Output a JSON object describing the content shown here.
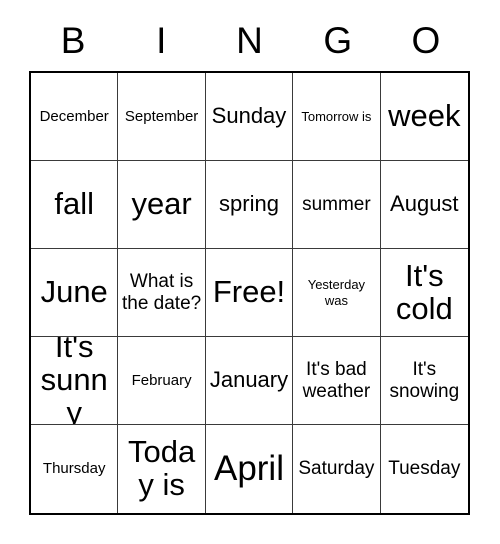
{
  "card": {
    "title": "BINGO",
    "header_letters": [
      "B",
      "I",
      "N",
      "G",
      "O"
    ],
    "grid_size": "5x5",
    "colors": {
      "background": "#ffffff",
      "text": "#000000",
      "outer_border": "#000000",
      "inner_gridline": "#3a3a3a"
    },
    "free_space": "Free!",
    "rows": [
      [
        {
          "text": "December",
          "size": "sm"
        },
        {
          "text": "September",
          "size": "sm"
        },
        {
          "text": "Sunday",
          "size": "lg"
        },
        {
          "text": "Tomorrow is",
          "size": "xs"
        },
        {
          "text": "week",
          "size": "xxl"
        }
      ],
      [
        {
          "text": "fall",
          "size": "xxl"
        },
        {
          "text": "year",
          "size": "xxl"
        },
        {
          "text": "spring",
          "size": "lg"
        },
        {
          "text": "summer",
          "size": "md"
        },
        {
          "text": "August",
          "size": "lg"
        }
      ],
      [
        {
          "text": "June",
          "size": "xxl"
        },
        {
          "text": "What is the date?",
          "size": "md"
        },
        {
          "text": "Free!",
          "size": "xxl"
        },
        {
          "text": "Yesterday was",
          "size": "xs"
        },
        {
          "text": "It's cold",
          "size": "xxl"
        }
      ],
      [
        {
          "text": "It's sunny",
          "size": "xxl"
        },
        {
          "text": "February",
          "size": "sm"
        },
        {
          "text": "January",
          "size": "lg"
        },
        {
          "text": "It's bad weather",
          "size": "md"
        },
        {
          "text": "It's snowing",
          "size": "md"
        }
      ],
      [
        {
          "text": "Thursday",
          "size": "sm"
        },
        {
          "text": "Today is",
          "size": "xxl"
        },
        {
          "text": "April",
          "size": "max"
        },
        {
          "text": "Saturday",
          "size": "md"
        },
        {
          "text": "Tuesday",
          "size": "md"
        }
      ]
    ]
  }
}
